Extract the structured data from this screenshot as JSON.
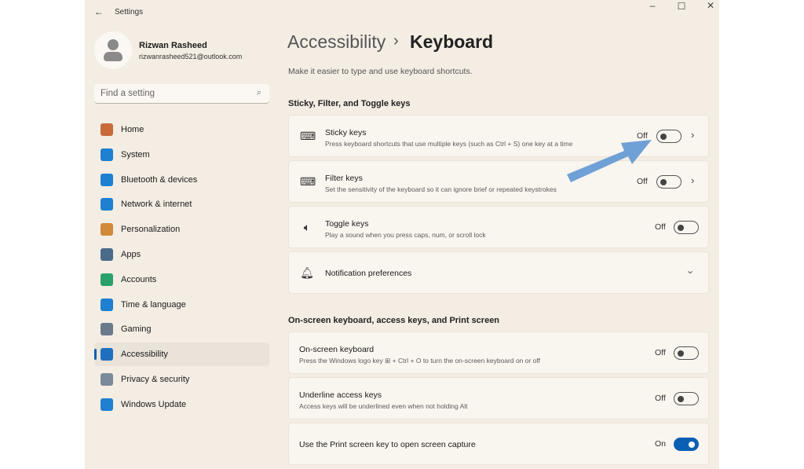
{
  "window": {
    "title": "Settings",
    "back_icon": "arrow-left-icon"
  },
  "profile": {
    "name": "Rizwan Rasheed",
    "email": "rizwanrasheed521@outlook.com"
  },
  "search": {
    "placeholder": "Find a setting"
  },
  "sidebar": {
    "items": [
      {
        "label": "Home",
        "icon": "home-icon",
        "color": "#c86a3a"
      },
      {
        "label": "System",
        "icon": "monitor-icon",
        "color": "#1f7fd0"
      },
      {
        "label": "Bluetooth & devices",
        "icon": "bluetooth-icon",
        "color": "#1f7fd0"
      },
      {
        "label": "Network & internet",
        "icon": "wifi-icon",
        "color": "#1f7fd0"
      },
      {
        "label": "Personalization",
        "icon": "brush-icon",
        "color": "#d08a3a"
      },
      {
        "label": "Apps",
        "icon": "apps-icon",
        "color": "#4a6a8a"
      },
      {
        "label": "Accounts",
        "icon": "person-icon",
        "color": "#2aa06a"
      },
      {
        "label": "Time & language",
        "icon": "globe-clock-icon",
        "color": "#1f7fd0"
      },
      {
        "label": "Gaming",
        "icon": "gamepad-icon",
        "color": "#6a7a8a"
      },
      {
        "label": "Accessibility",
        "icon": "accessibility-icon",
        "color": "#1f6fc0",
        "selected": true
      },
      {
        "label": "Privacy & security",
        "icon": "shield-icon",
        "color": "#7a8a9a"
      },
      {
        "label": "Windows Update",
        "icon": "update-icon",
        "color": "#1f7fd0"
      }
    ]
  },
  "main": {
    "breadcrumb_parent": "Accessibility",
    "breadcrumb_sep": "›",
    "title": "Keyboard",
    "subtitle": "Make it easier to type and use keyboard shortcuts.",
    "section1": "Sticky, Filter, and Toggle keys",
    "section2": "On-screen keyboard, access keys, and Print screen",
    "cards": [
      {
        "title": "Sticky keys",
        "desc": "Press keyboard shortcuts that use multiple keys (such as Ctrl + S) one key at a time",
        "state": "Off"
      },
      {
        "title": "Filter keys",
        "desc": "Set the sensitivity of the keyboard so it can ignore brief or repeated keystrokes",
        "state": "Off"
      },
      {
        "title": "Toggle keys",
        "desc": "Play a sound when you press caps, num, or scroll lock",
        "state": "Off"
      },
      {
        "title": "Notification preferences"
      },
      {
        "title": "On-screen keyboard",
        "desc": "Press the Windows logo key ⊞ + Ctrl + O to turn the on-screen keyboard on or off",
        "state": "Off"
      },
      {
        "title": "Underline access keys",
        "desc": "Access keys will be underlined even when not holding Alt",
        "state": "Off"
      },
      {
        "title": "Use the Print screen key to open screen capture",
        "state": "On"
      }
    ]
  },
  "annotation": {
    "arrow_color": "#6fa0d6"
  }
}
